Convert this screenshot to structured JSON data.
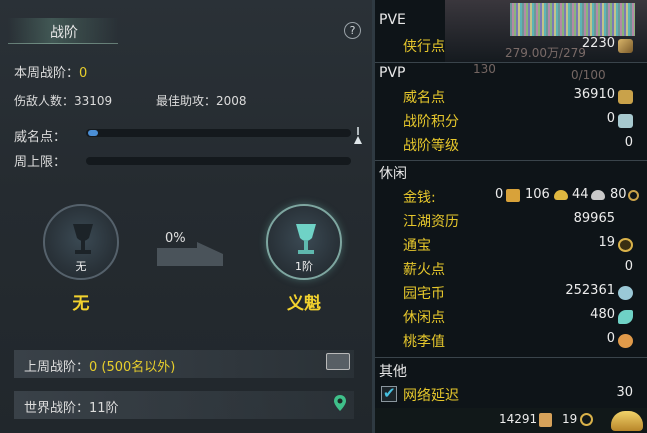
{
  "left": {
    "title": "战阶",
    "help": "?",
    "weekly_rank_label": "本周战阶：",
    "weekly_rank_value": "0",
    "kills_label": "伤敌人数：",
    "kills_value": "33109",
    "assist_label": "最佳助攻：",
    "assist_value": "2008",
    "prestige_label": "威名点：",
    "prestige_progress": 0.04,
    "weekly_cap_label": "周上限：",
    "weekly_cap_progress": 0,
    "current_emblem_caption": "无",
    "current_rank_name": "无",
    "next_emblem_caption": "1阶",
    "next_rank_name": "义魁",
    "progress_pct": "0%",
    "last_week_label": "上周战阶：",
    "last_week_value": "0 (500名以外)",
    "world_rank_label": "世界战阶：",
    "world_rank_value": "11阶"
  },
  "right": {
    "pve": {
      "heading": "PVE",
      "items": [
        {
          "label": "侠行点",
          "value": "2230",
          "icon": "sword-icon"
        }
      ]
    },
    "pvp": {
      "heading": "PVP",
      "items": [
        {
          "label": "威名点",
          "value": "36910",
          "icon": "tiger-icon"
        },
        {
          "label": "战阶积分",
          "value": "0",
          "icon": "shield-icon"
        },
        {
          "label": "战阶等级",
          "value": "0",
          "icon": ""
        }
      ]
    },
    "leisure": {
      "heading": "休闲",
      "money_label": "金钱:",
      "money_values": [
        "0",
        "106",
        "44",
        "80"
      ],
      "items": [
        {
          "label": "江湖资历",
          "value": "89965",
          "icon": ""
        },
        {
          "label": "通宝",
          "value": "19",
          "icon": "coin-icon"
        },
        {
          "label": "薪火点",
          "value": "0",
          "icon": ""
        },
        {
          "label": "园宅币",
          "value": "252361",
          "icon": "house-coin-icon"
        },
        {
          "label": "休闲点",
          "value": "480",
          "icon": "leaf-icon"
        },
        {
          "label": "桃李值",
          "value": "0",
          "icon": "peach-icon"
        }
      ]
    },
    "other": {
      "heading": "其他",
      "latency_label": "网络延迟",
      "latency_value": "30"
    },
    "bottom": {
      "value_a": "14291",
      "value_b": "19"
    },
    "background_text": {
      "t1": "279.00万/279",
      "t2": "130",
      "t3": "0/100"
    }
  }
}
